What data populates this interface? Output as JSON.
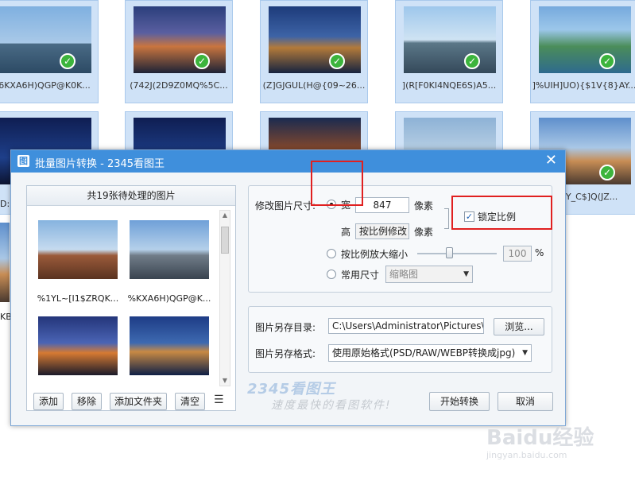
{
  "gallery": {
    "tiles": [
      {
        "caption": "6KXA6H)QGP@K0K...",
        "checked": true
      },
      {
        "caption": "(742J(2D9Z0MQ%5C...",
        "checked": true
      },
      {
        "caption": "(Z]GJGUL(H@{09~26...",
        "checked": true
      },
      {
        "caption": "](R[F0KI4NQE6S)A5...",
        "checked": true
      },
      {
        "caption": "]%UIH]UO){$1V{8}AY...",
        "checked": true
      },
      {
        "caption": "",
        "checked": false
      },
      {
        "caption": "",
        "checked": false
      },
      {
        "caption": "",
        "checked": false
      },
      {
        "caption": "",
        "checked": false
      },
      {
        "caption": "O%Y_C$]Q(JZ...",
        "checked": true
      }
    ],
    "left_edge_labels": [
      "D:",
      "KB"
    ]
  },
  "dialog": {
    "title": "批量图片转换 - 2345看图王",
    "close_glyph": "✕",
    "app_icon_glyph": "图"
  },
  "left_panel": {
    "header": "共19张待处理的图片",
    "images": [
      {
        "caption": "%1YL~[I1$ZRQK..."
      },
      {
        "caption": "%KXA6H)QGP@K..."
      },
      {
        "caption": ""
      },
      {
        "caption": ""
      }
    ],
    "buttons": {
      "add": "添加",
      "remove": "移除",
      "add_folder": "添加文件夹",
      "clear": "清空"
    },
    "menu_glyph": "☰"
  },
  "resize": {
    "label": "修改图片尺寸:",
    "width_label": "宽",
    "width_value": "847",
    "width_unit": "像素",
    "height_label": "高",
    "height_value": "按比例修改",
    "height_unit": "像素",
    "lock_ratio_label": "锁定比例",
    "lock_ratio_checked": true,
    "scale_label": "按比例放大缩小",
    "scale_value": "100",
    "scale_unit": "%",
    "scale_level": 0.4,
    "common_size_label": "常用尺寸",
    "common_size_value": "缩略图"
  },
  "output": {
    "dir_label": "图片另存目录:",
    "dir_value": "C:\\Users\\Administrator\\Pictures\\",
    "browse_button": "浏览...",
    "format_label": "图片另存格式:",
    "format_value": "使用原始格式(PSD/RAW/WEBP转换成jpg)"
  },
  "footer": {
    "brand": "2345看图王",
    "slogan": "速度最快的看图软件!",
    "start_button": "开始转换",
    "cancel_button": "取消"
  },
  "watermark": {
    "text": "Baidu经验",
    "url": "jingyan.baidu.com"
  },
  "colors": {
    "titlebar": "#3f8fdc",
    "highlight": "#e02020",
    "check_green": "#3cb43c"
  }
}
